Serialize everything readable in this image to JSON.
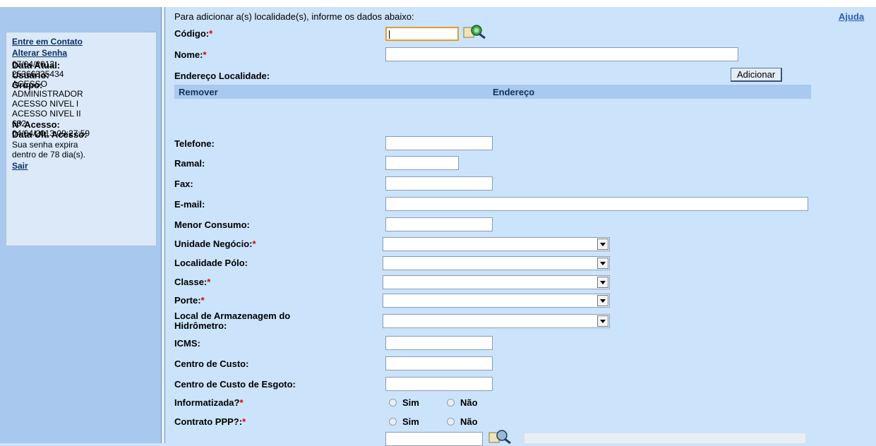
{
  "sidebar": {
    "contact_link": "Entre em Contato",
    "password_link": "Alterar Senha",
    "date_label": "Data Atual:",
    "date_value": "07/04/2013",
    "user_label": "Usuário:",
    "user_value": "25366335434",
    "group_label": "Grupo:",
    "groups": [
      "ACESSO",
      "ADMINISTRADOR",
      "ACESSO NIVEL I",
      "ACESSO NIVEL II"
    ],
    "access_label": "Nº Acesso:",
    "access_value": "632",
    "last_access_label": "Data Ult. Acesso:",
    "last_access_value": "04/04/2013 09:27:59",
    "expiry_text_1": "Sua senha expira",
    "expiry_text_2": "dentro de 78 dia(s).",
    "logout_link": "Sair"
  },
  "form": {
    "intro": "Para adicionar a(s) localidade(s), informe os dados abaixo:",
    "help_link": "Ajuda",
    "codigo_label": "Código:",
    "nome_label": "Nome:",
    "endereco_label": "Endereço Localidade:",
    "add_button": "Adicionar",
    "table_remover": "Remover",
    "table_endereco": "Endereço",
    "telefone_label": "Telefone:",
    "ramal_label": "Ramal:",
    "fax_label": "Fax:",
    "email_label": "E-mail:",
    "menor_consumo_label": "Menor Consumo:",
    "unidade_label": "Unidade Negócio:",
    "localidade_polo_label": "Localidade Pólo:",
    "classe_label": "Classe:",
    "porte_label": "Porte:",
    "armazenagem_label_1": "Local de Armazenagem do",
    "armazenagem_label_2": "Hidrômetro:",
    "icms_label": "ICMS:",
    "centro_custo_label": "Centro de Custo:",
    "centro_custo_esgoto_label": "Centro de Custo de Esgoto:",
    "informatizada_label": "Informatizada?",
    "contrato_label": "Contrato PPP?:",
    "sim": "Sim",
    "nao": "Não",
    "required_mark": "*"
  }
}
